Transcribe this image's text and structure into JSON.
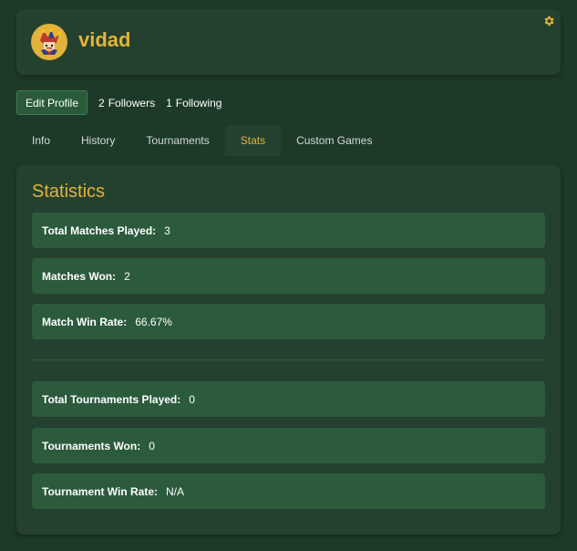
{
  "profile": {
    "username": "vidad",
    "avatar_icon": "jester-icon",
    "accent_color": "#e2b33a"
  },
  "social": {
    "edit_label": "Edit Profile",
    "followers_count": "2",
    "followers_label": "Followers",
    "following_count": "1",
    "following_label": "Following"
  },
  "tabs": [
    {
      "label": "Info"
    },
    {
      "label": "History"
    },
    {
      "label": "Tournaments"
    },
    {
      "label": "Stats",
      "active": true
    },
    {
      "label": "Custom Games"
    }
  ],
  "stats": {
    "title": "Statistics",
    "match_rows": [
      {
        "label": "Total Matches Played:",
        "value": "3"
      },
      {
        "label": "Matches Won:",
        "value": "2"
      },
      {
        "label": "Match Win Rate:",
        "value": "66.67%"
      }
    ],
    "tournament_rows": [
      {
        "label": "Total Tournaments Played:",
        "value": "0"
      },
      {
        "label": "Tournaments Won:",
        "value": "0"
      },
      {
        "label": "Tournament Win Rate:",
        "value": "N/A"
      }
    ]
  }
}
